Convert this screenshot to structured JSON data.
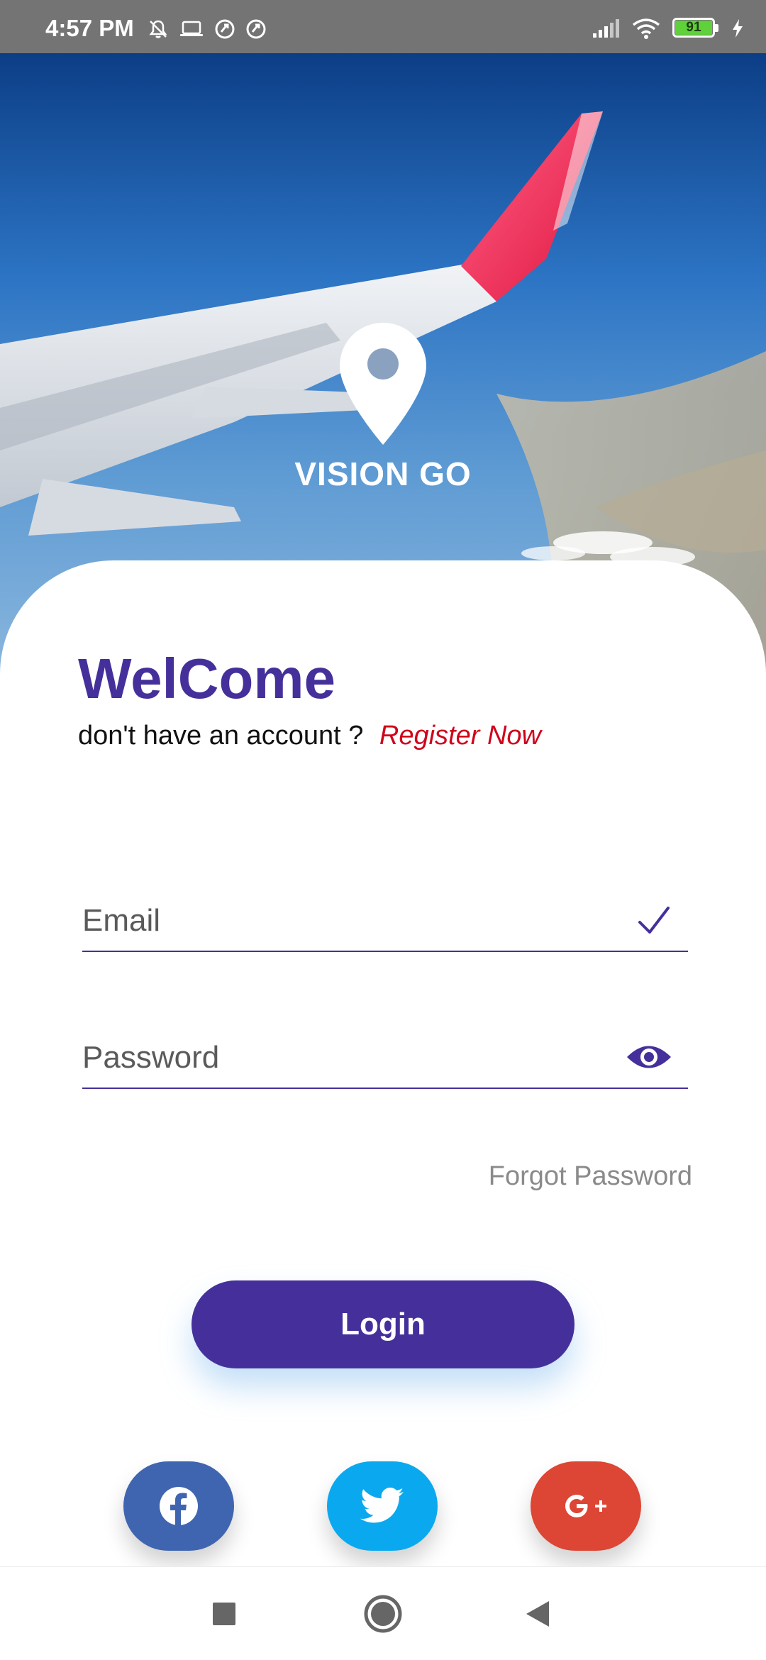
{
  "status_bar": {
    "time": "4:57 PM",
    "left_icons": [
      "bell-off-icon",
      "laptop-icon",
      "sync-icon",
      "sync-icon"
    ],
    "right_icons": [
      "signal-icon",
      "wifi-icon",
      "battery-icon",
      "charging-icon"
    ],
    "battery_level": "91",
    "battery_color": "#5fd13b"
  },
  "hero": {
    "app_name": "VISION GO",
    "logo_icon": "map-pin-icon"
  },
  "login": {
    "title": "WelCome",
    "account_prompt": "don't have an account ?",
    "register_link": "Register Now",
    "email_placeholder": "Email",
    "email_icon": "check-icon",
    "password_placeholder": "Password",
    "password_icon": "eye-icon",
    "forgot_password": "Forgot Password",
    "login_button": "Login"
  },
  "social": [
    {
      "name": "facebook",
      "icon": "facebook-icon",
      "color": "#3f65b0"
    },
    {
      "name": "twitter",
      "icon": "twitter-icon",
      "color": "#0aa9ef"
    },
    {
      "name": "google-plus",
      "icon": "google-plus-icon",
      "color": "#dd4534",
      "label": "G+"
    }
  ],
  "nav_bar": {
    "buttons": [
      "recent-apps-icon",
      "home-icon",
      "back-icon"
    ]
  },
  "colors": {
    "primary": "#45309b",
    "link_red": "#d0021b",
    "muted_text": "#8a8a8a",
    "status_bar": "#747474"
  }
}
